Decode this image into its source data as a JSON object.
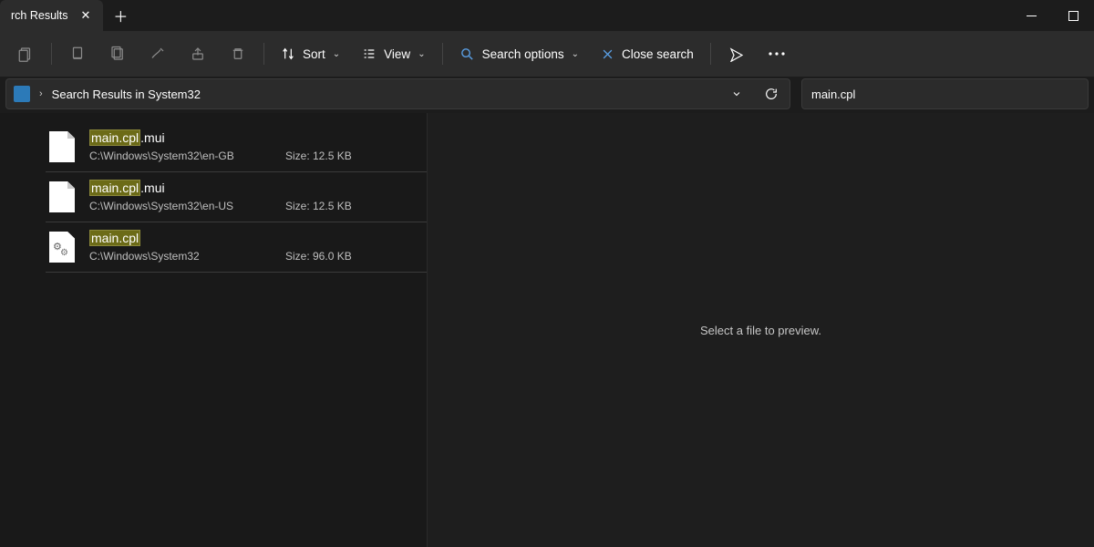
{
  "tab": {
    "title": "rch Results"
  },
  "toolbar": {
    "sort_label": "Sort",
    "view_label": "View",
    "search_options_label": "Search options",
    "close_search_label": "Close search"
  },
  "address": {
    "crumb": "Search Results in System32"
  },
  "search": {
    "value": "main.cpl"
  },
  "results": [
    {
      "highlight": "main.cpl",
      "suffix": ".mui",
      "path": "C:\\Windows\\System32\\en-GB",
      "size": "Size: 12.5 KB",
      "icon": "doc"
    },
    {
      "highlight": "main.cpl",
      "suffix": ".mui",
      "path": "C:\\Windows\\System32\\en-US",
      "size": "Size: 12.5 KB",
      "icon": "doc"
    },
    {
      "highlight": "main.cpl",
      "suffix": "",
      "path": "C:\\Windows\\System32",
      "size": "Size: 96.0 KB",
      "icon": "cpl"
    }
  ],
  "preview": {
    "placeholder": "Select a file to preview."
  }
}
